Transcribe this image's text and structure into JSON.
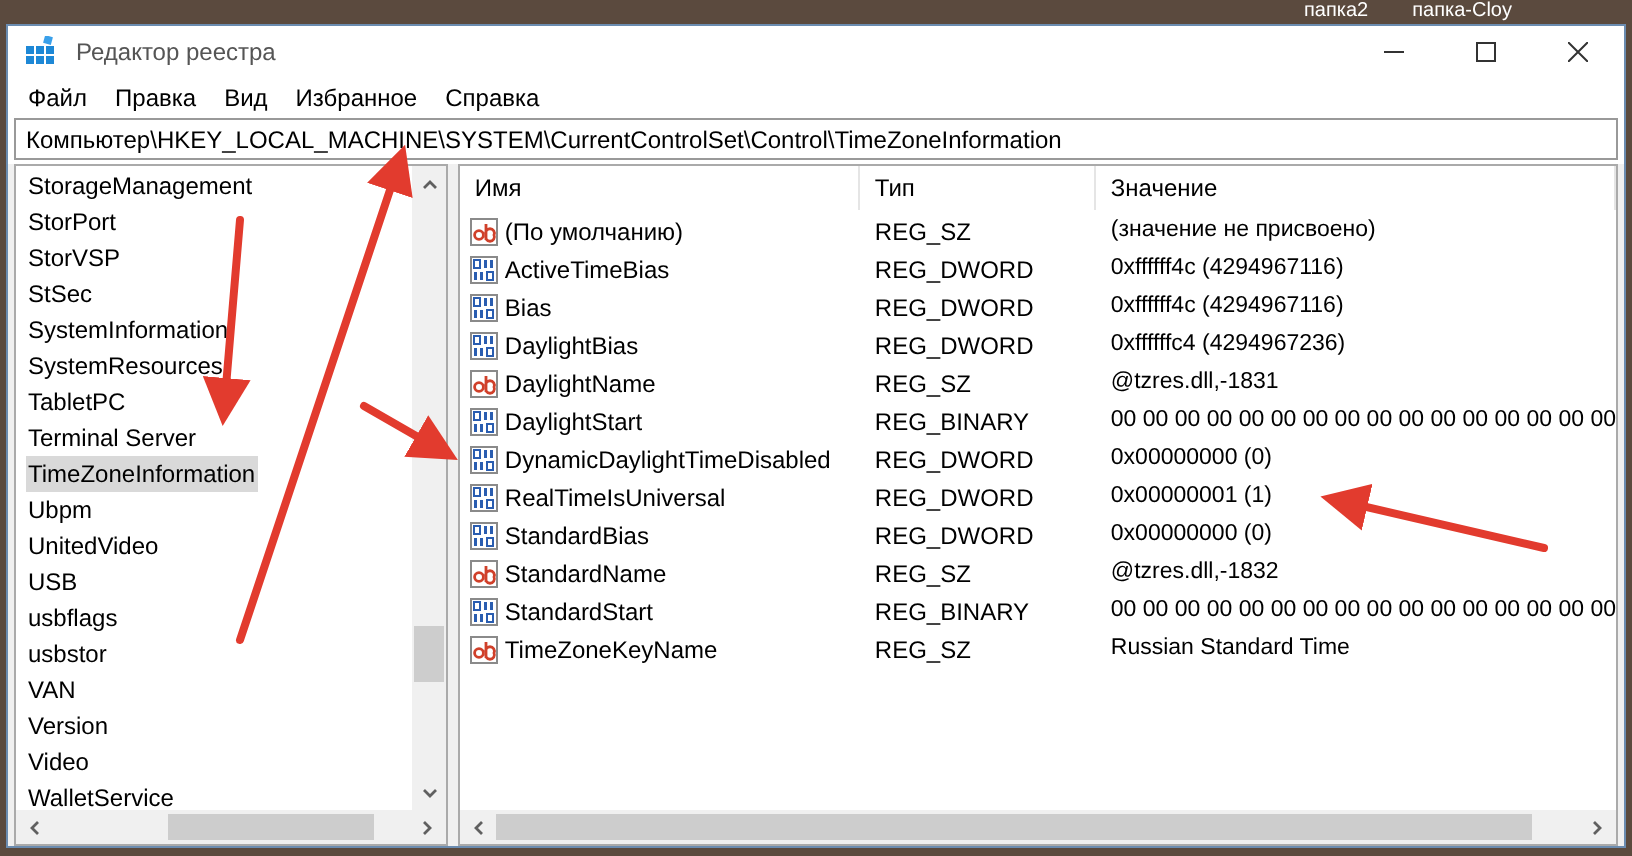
{
  "desktop": {
    "labels": [
      "папка2",
      "папка-Cloy"
    ]
  },
  "window": {
    "title": "Редактор реестра"
  },
  "menu": [
    "Файл",
    "Правка",
    "Вид",
    "Избранное",
    "Справка"
  ],
  "address_bar": {
    "value": "Компьютер\\HKEY_LOCAL_MACHINE\\SYSTEM\\CurrentControlSet\\Control\\TimeZoneInformation"
  },
  "tree": {
    "items": [
      {
        "label": "StorageManagement",
        "selected": false
      },
      {
        "label": "StorPort",
        "selected": false
      },
      {
        "label": "StorVSP",
        "selected": false
      },
      {
        "label": "StSec",
        "selected": false
      },
      {
        "label": "SystemInformation",
        "selected": false
      },
      {
        "label": "SystemResources",
        "selected": false
      },
      {
        "label": "TabletPC",
        "selected": false
      },
      {
        "label": "Terminal Server",
        "selected": false
      },
      {
        "label": "TimeZoneInformation",
        "selected": true
      },
      {
        "label": "Ubpm",
        "selected": false
      },
      {
        "label": "UnitedVideo",
        "selected": false
      },
      {
        "label": "USB",
        "selected": false
      },
      {
        "label": "usbflags",
        "selected": false
      },
      {
        "label": "usbstor",
        "selected": false
      },
      {
        "label": "VAN",
        "selected": false
      },
      {
        "label": "Version",
        "selected": false
      },
      {
        "label": "Video",
        "selected": false
      },
      {
        "label": "WalletService",
        "selected": false
      }
    ]
  },
  "table": {
    "columns": [
      "Имя",
      "Тип",
      "Значение"
    ],
    "rows": [
      {
        "kind": "string",
        "name": "(По умолчанию)",
        "type": "REG_SZ",
        "value": "(значение не присвоено)"
      },
      {
        "kind": "binary",
        "name": "ActiveTimeBias",
        "type": "REG_DWORD",
        "value": "0xffffff4c (4294967116)"
      },
      {
        "kind": "binary",
        "name": "Bias",
        "type": "REG_DWORD",
        "value": "0xffffff4c (4294967116)"
      },
      {
        "kind": "binary",
        "name": "DaylightBias",
        "type": "REG_DWORD",
        "value": "0xffffffc4 (4294967236)"
      },
      {
        "kind": "string",
        "name": "DaylightName",
        "type": "REG_SZ",
        "value": "@tzres.dll,-1831"
      },
      {
        "kind": "binary",
        "name": "DaylightStart",
        "type": "REG_BINARY",
        "value": "00 00 00 00 00 00 00 00 00 00 00 00 00 00 00 00"
      },
      {
        "kind": "binary",
        "name": "DynamicDaylightTimeDisabled",
        "type": "REG_DWORD",
        "value": "0x00000000 (0)"
      },
      {
        "kind": "binary",
        "name": "RealTimeIsUniversal",
        "type": "REG_DWORD",
        "value": "0x00000001 (1)"
      },
      {
        "kind": "binary",
        "name": "StandardBias",
        "type": "REG_DWORD",
        "value": "0x00000000 (0)"
      },
      {
        "kind": "string",
        "name": "StandardName",
        "type": "REG_SZ",
        "value": "@tzres.dll,-1832"
      },
      {
        "kind": "binary",
        "name": "StandardStart",
        "type": "REG_BINARY",
        "value": "00 00 00 00 00 00 00 00 00 00 00 00 00 00 00 00"
      },
      {
        "kind": "string",
        "name": "TimeZoneKeyName",
        "type": "REG_SZ",
        "value": "Russian Standard Time"
      }
    ]
  }
}
